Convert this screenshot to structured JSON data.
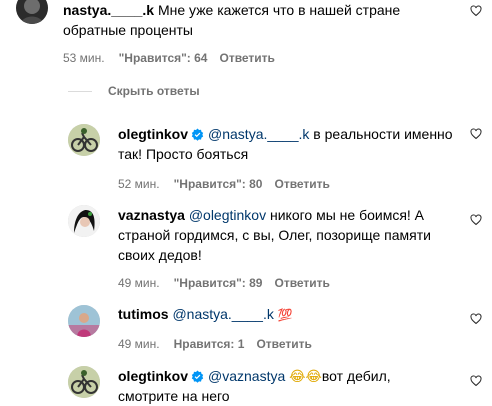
{
  "comments": [
    {
      "username": "nastya.____.k",
      "text_line1": " Мне уже кажется что в нашей стране",
      "text_line2": "обратные проценты",
      "time": "53 мин.",
      "likes": "\"Нравится\": 64",
      "reply": "Ответить"
    },
    {
      "username": "olegtinkov",
      "mention": "@nastya.____.k",
      "text_line1_rest": " в реальности именно",
      "text_line2": "так! Просто бояться",
      "time": "52 мин.",
      "likes": "\"Нравится\": 80",
      "reply": "Ответить"
    },
    {
      "username": "vaznastya",
      "mention": "@olegtinkov",
      "text_line1_rest": " никого мы не боимся! А",
      "text_line2": "страной гордимся, с вы, Олег, позорище памяти",
      "text_line3": "своих дедов!",
      "time": "49 мин.",
      "likes": "\"Нравится\": 89",
      "reply": "Ответить"
    },
    {
      "username": "tutimos",
      "mention": "@nastya.____.k",
      "emoji": "💯",
      "time": "49 мин.",
      "likes": "Нравится: 1",
      "reply": "Ответить"
    },
    {
      "username": "olegtinkov",
      "mention": "@vaznastya",
      "emoji": "😂😂",
      "text_line1_rest": "вот дебил,",
      "text_line2": "смотрите на него"
    }
  ],
  "hide_replies_label": "Скрыть ответы",
  "icons": {
    "like": "heart-outline-icon",
    "verified": "verified-badge-icon"
  },
  "colors": {
    "mention": "#00376b",
    "meta": "#737373",
    "verified": "#0095f6"
  }
}
